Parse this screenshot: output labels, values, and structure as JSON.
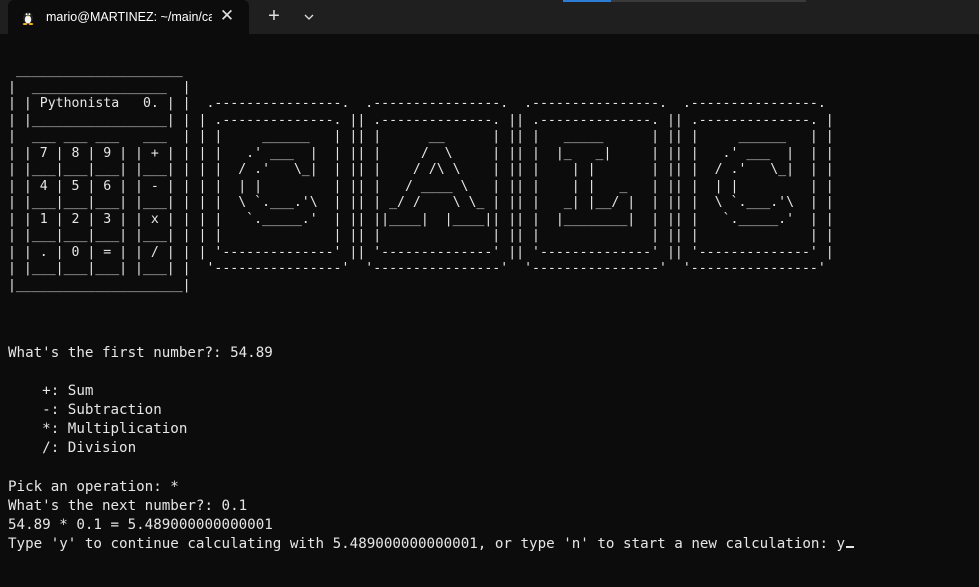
{
  "tab": {
    "title": "mario@MARTINEZ: ~/main/ca",
    "icon": "linux-tux-icon",
    "close_icon": "close-icon"
  },
  "toolbar": {
    "new_tab_label": "+",
    "dropdown_icon": "chevron-down-icon"
  },
  "colors": {
    "background": "#0c0c0c",
    "titlebar": "#1f1f1f",
    "text": "#cccccc",
    "accent": "#2d7cd6"
  },
  "terminal": {
    "ascii_art": " _____________________\n|  _________________  |\n| | Pythonista   0. | |  .----------------.  .----------------.  .----------------.  .----------------.\n| |_________________| | | .--------------. || .--------------. || .--------------. || .--------------. |\n|  ___ ___ ___   ___  | | |     ______   | || |      __      | || |   _____      | || |     ______   | |\n| | 7 | 8 | 9 | | + | | | |   .' ___  |  | || |     /  \\     | || |  |_   _|     | || |   .' ___  |  | |\n| |___|___|___| |___| | | |  / .'   \\_|  | || |    / /\\ \\    | || |    | |       | || |  / .'   \\_|  | |\n| | 4 | 5 | 6 | | - | | | |  | |         | || |   / ____ \\   | || |    | |   _   | || |  | |         | |\n| |___|___|___| |___| | | |  \\ `.___.'\\  | || | _/ /    \\ \\_ | || |   _| |__/ |  | || |  \\ `.___.'\\  | |\n| | 1 | 2 | 3 | | x | | | |   `._____.'  | || ||____|  |____|| || |  |________|  | || |   `._____.'  | |\n| |___|___|___| |___| | | |              | || |              | || |              | || |              | |\n| | . | 0 | = | | / | | | '--------------' || '--------------' || '--------------' || '--------------' |\n| |___|___|___| |___| |  '----------------'  '----------------'  '----------------'  '----------------'\n|_____________________|",
    "lines": [
      "What's the first number?: 54.89",
      "",
      "    +: Sum",
      "    -: Subtraction",
      "    *: Multiplication",
      "    /: Division",
      "",
      "Pick an operation: *",
      "What's the next number?: 0.1",
      "54.89 * 0.1 = 5.489000000000001"
    ],
    "prompt": "Type 'y' to continue calculating with 5.489000000000001, or type 'n' to start a new calculation: y"
  }
}
